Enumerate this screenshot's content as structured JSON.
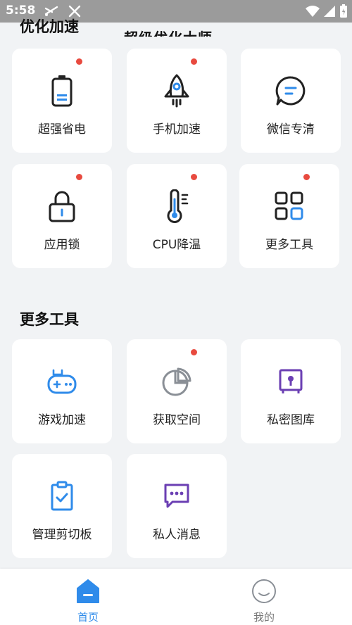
{
  "status_bar": {
    "time": "5:58"
  },
  "header": {
    "app_title": "超级优化大师"
  },
  "sections": {
    "optimize_title": "优化加速",
    "more_tools_title": "更多工具"
  },
  "optimize_items": [
    {
      "label": "超强省电",
      "icon": "battery-icon",
      "badge": true
    },
    {
      "label": "手机加速",
      "icon": "rocket-icon",
      "badge": true
    },
    {
      "label": "微信专清",
      "icon": "chat-bubble-icon",
      "badge": false
    },
    {
      "label": "应用锁",
      "icon": "lock-icon",
      "badge": true
    },
    {
      "label": "CPU降温",
      "icon": "thermometer-icon",
      "badge": true
    },
    {
      "label": "更多工具",
      "icon": "grid-icon",
      "badge": true
    }
  ],
  "more_tools_items": [
    {
      "label": "游戏加速",
      "icon": "gamepad-icon",
      "badge": false
    },
    {
      "label": "获取空间",
      "icon": "pie-chart-icon",
      "badge": true
    },
    {
      "label": "私密图库",
      "icon": "private-gallery-icon",
      "badge": false
    },
    {
      "label": "管理剪切板",
      "icon": "clipboard-icon",
      "badge": false
    },
    {
      "label": "私人消息",
      "icon": "message-icon",
      "badge": false
    }
  ],
  "bottom_nav": {
    "home_label": "首页",
    "mine_label": "我的"
  },
  "colors": {
    "accent_blue": "#2f8bea",
    "badge_red": "#e84a3f",
    "purple": "#6b3fb3",
    "nav_inactive": "#777777"
  }
}
